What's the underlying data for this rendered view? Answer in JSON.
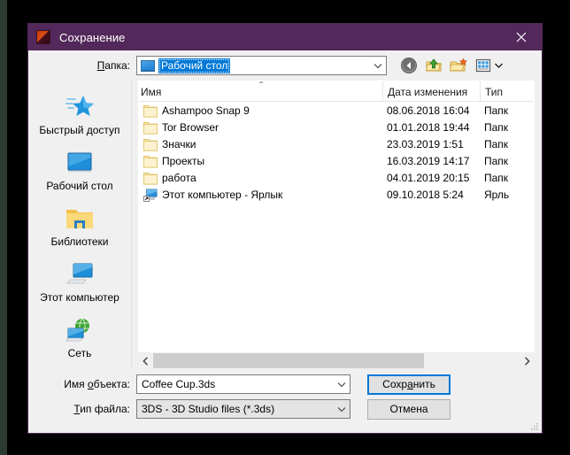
{
  "window": {
    "title": "Сохранение",
    "title_icon": "app-logo-icon",
    "close_icon": "close-icon",
    "titlebar_color": "#53285a",
    "accent_color": "#0078d7"
  },
  "folder_bar": {
    "label_prefix": "П",
    "label_rest": "апка:",
    "selected_folder": "Рабочий стол",
    "folder_icon": "desktop-icon",
    "dropdown_icon": "chevron-down-icon",
    "tools": [
      {
        "name": "back-button",
        "icon": "back-arrow-icon"
      },
      {
        "name": "up-level-button",
        "icon": "folder-up-icon"
      },
      {
        "name": "new-folder-button",
        "icon": "new-folder-icon"
      },
      {
        "name": "views-button",
        "icon": "views-grid-icon"
      }
    ],
    "views_dropdown_icon": "chevron-down-icon"
  },
  "sidebar": {
    "items": [
      {
        "label": "Быстрый доступ",
        "icon": "quick-access-star-icon"
      },
      {
        "label": "Рабочий стол",
        "icon": "desktop-monitor-icon"
      },
      {
        "label": "Библиотеки",
        "icon": "libraries-folder-icon"
      },
      {
        "label": "Этот компьютер",
        "icon": "this-pc-icon"
      },
      {
        "label": "Сеть",
        "icon": "network-globe-icon"
      }
    ]
  },
  "file_list": {
    "columns": [
      "Имя",
      "Дата изменения",
      "Тип"
    ],
    "sort_indicator": "⌃",
    "rows": [
      {
        "name": "Ashampoo Snap 9",
        "date": "08.06.2018 16:04",
        "type": "Папк",
        "icon": "folder-icon"
      },
      {
        "name": "Tor Browser",
        "date": "01.01.2018 19:44",
        "type": "Папк",
        "icon": "folder-icon"
      },
      {
        "name": "Значки",
        "date": "23.03.2019 1:51",
        "type": "Папк",
        "icon": "folder-icon"
      },
      {
        "name": "Проекты",
        "date": "16.03.2019 14:17",
        "type": "Папк",
        "icon": "folder-icon"
      },
      {
        "name": "работа",
        "date": "04.01.2019 20:15",
        "type": "Папк",
        "icon": "folder-icon"
      },
      {
        "name": "Этот компьютер - Ярлык",
        "date": "09.10.2018 5:24",
        "type": "Ярль",
        "icon": "shortcut-computer-icon"
      }
    ],
    "scroll_left_icon": "chevron-left-icon",
    "scroll_right_icon": "chevron-right-icon"
  },
  "form": {
    "filename_label_prefix": "Имя ",
    "filename_label_accel": "о",
    "filename_label_rest": "бъекта:",
    "filename_value": "Coffee Cup.3ds",
    "filetype_label_accel": "Т",
    "filetype_label_rest": "ип файла:",
    "filetype_value": "3DS - 3D Studio files (*.3ds)",
    "save_button_prefix": "Сохр",
    "save_button_accel": "а",
    "save_button_rest": "нить",
    "cancel_button": "Отмена",
    "dropdown_icon": "chevron-down-icon",
    "resize_grip": "resize-grip-icon"
  }
}
